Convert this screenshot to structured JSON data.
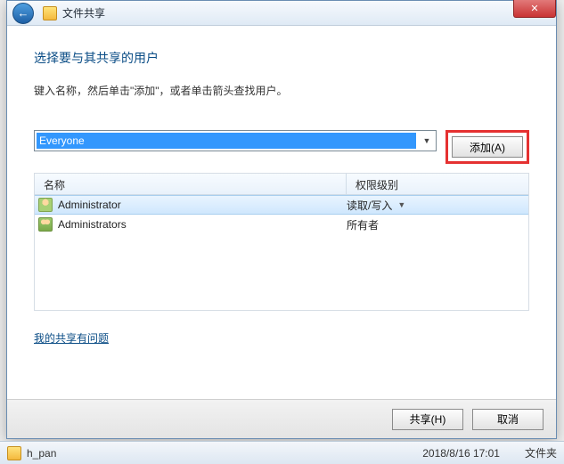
{
  "window": {
    "title": "文件共享"
  },
  "dialog": {
    "heading": "选择要与其共享的用户",
    "subtext": "键入名称，然后单击\"添加\"，或者单击箭头查找用户。",
    "combo_value": "Everyone",
    "add_button": "添加(A)",
    "help_link": "我的共享有问题"
  },
  "list": {
    "col_name": "名称",
    "col_perm": "权限级别",
    "rows": [
      {
        "name": "Administrator",
        "perm": "读取/写入",
        "dropdown": true,
        "icon": "user"
      },
      {
        "name": "Administrators",
        "perm": "所有者",
        "dropdown": false,
        "icon": "group"
      }
    ]
  },
  "footer": {
    "share": "共享(H)",
    "cancel": "取消"
  },
  "statusbar": {
    "folder": "h_pan",
    "date": "2018/8/16 17:01",
    "type": "文件夹"
  }
}
